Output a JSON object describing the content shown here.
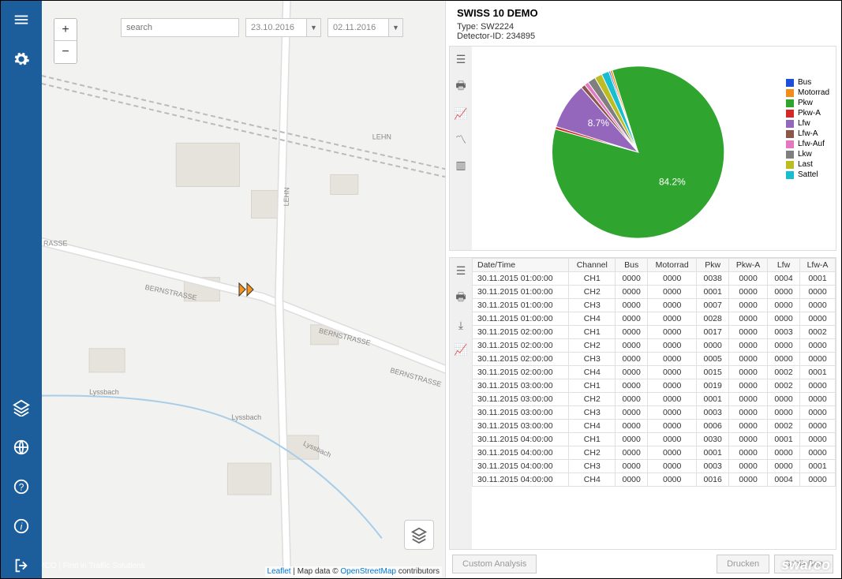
{
  "sidebar": {
    "footer_brand": "SWARCO | First in Traffic Solutions"
  },
  "topbar": {
    "search_placeholder": "search",
    "date_from": "23.10.2016",
    "date_to": "02.11.2016"
  },
  "map": {
    "attrib_prefix": "Leaflet",
    "attrib_mid": " | Map data © ",
    "attrib_link": "OpenStreetMap",
    "attrib_suffix": " contributors",
    "labels": {
      "bernstrasse": "BERNSTRASSE",
      "lehn": "LEHN",
      "lyssbach": "Lyssbach",
      "rasse": "RASSE"
    }
  },
  "detail": {
    "title": "SWISS 10 DEMO",
    "type_label": "Type: ",
    "type_value": "SW2224",
    "id_label": "Detector-ID: ",
    "id_value": "234895"
  },
  "chart_data": {
    "type": "pie",
    "title": "",
    "series": [
      {
        "name": "Bus",
        "value": 0.3,
        "color": "#1f4fd6"
      },
      {
        "name": "Motorrad",
        "value": 0.4,
        "color": "#f28c1b"
      },
      {
        "name": "Pkw",
        "value": 84.2,
        "color": "#2fa52f"
      },
      {
        "name": "Pkw-A",
        "value": 0.5,
        "color": "#d62728"
      },
      {
        "name": "Lfw",
        "value": 8.7,
        "color": "#9467bd"
      },
      {
        "name": "Lfw-A",
        "value": 0.8,
        "color": "#8c564b"
      },
      {
        "name": "Lfw-Auf",
        "value": 0.8,
        "color": "#e377c2"
      },
      {
        "name": "Lkw",
        "value": 1.5,
        "color": "#7f7f7f"
      },
      {
        "name": "Last",
        "value": 1.4,
        "color": "#bcbd22"
      },
      {
        "name": "Sattel",
        "value": 1.4,
        "color": "#17becf"
      }
    ],
    "labels_shown": [
      {
        "name": "Pkw",
        "text": "84.2%"
      },
      {
        "name": "Lfw",
        "text": "8.7%"
      }
    ]
  },
  "table": {
    "columns": [
      "Date/Time",
      "Channel",
      "Bus",
      "Motorrad",
      "Pkw",
      "Pkw-A",
      "Lfw",
      "Lfw-A"
    ],
    "rows": [
      [
        "30.11.2015 01:00:00",
        "CH1",
        "0000",
        "0000",
        "0038",
        "0000",
        "0004",
        "0001"
      ],
      [
        "30.11.2015 01:00:00",
        "CH2",
        "0000",
        "0000",
        "0001",
        "0000",
        "0000",
        "0000"
      ],
      [
        "30.11.2015 01:00:00",
        "CH3",
        "0000",
        "0000",
        "0007",
        "0000",
        "0000",
        "0000"
      ],
      [
        "30.11.2015 01:00:00",
        "CH4",
        "0000",
        "0000",
        "0028",
        "0000",
        "0000",
        "0000"
      ],
      [
        "30.11.2015 02:00:00",
        "CH1",
        "0000",
        "0000",
        "0017",
        "0000",
        "0003",
        "0002"
      ],
      [
        "30.11.2015 02:00:00",
        "CH2",
        "0000",
        "0000",
        "0000",
        "0000",
        "0000",
        "0000"
      ],
      [
        "30.11.2015 02:00:00",
        "CH3",
        "0000",
        "0000",
        "0005",
        "0000",
        "0000",
        "0000"
      ],
      [
        "30.11.2015 02:00:00",
        "CH4",
        "0000",
        "0000",
        "0015",
        "0000",
        "0002",
        "0001"
      ],
      [
        "30.11.2015 03:00:00",
        "CH1",
        "0000",
        "0000",
        "0019",
        "0000",
        "0002",
        "0000"
      ],
      [
        "30.11.2015 03:00:00",
        "CH2",
        "0000",
        "0000",
        "0001",
        "0000",
        "0000",
        "0000"
      ],
      [
        "30.11.2015 03:00:00",
        "CH3",
        "0000",
        "0000",
        "0003",
        "0000",
        "0000",
        "0000"
      ],
      [
        "30.11.2015 03:00:00",
        "CH4",
        "0000",
        "0000",
        "0006",
        "0000",
        "0002",
        "0000"
      ],
      [
        "30.11.2015 04:00:00",
        "CH1",
        "0000",
        "0000",
        "0030",
        "0000",
        "0001",
        "0000"
      ],
      [
        "30.11.2015 04:00:00",
        "CH2",
        "0000",
        "0000",
        "0001",
        "0000",
        "0000",
        "0000"
      ],
      [
        "30.11.2015 04:00:00",
        "CH3",
        "0000",
        "0000",
        "0003",
        "0000",
        "0000",
        "0001"
      ],
      [
        "30.11.2015 04:00:00",
        "CH4",
        "0000",
        "0000",
        "0016",
        "0000",
        "0004",
        "0000"
      ]
    ]
  },
  "buttons": {
    "custom_analysis": "Custom Analysis",
    "drucken": "Drucken",
    "schliessen": "Schließen"
  },
  "brand": "swarco"
}
